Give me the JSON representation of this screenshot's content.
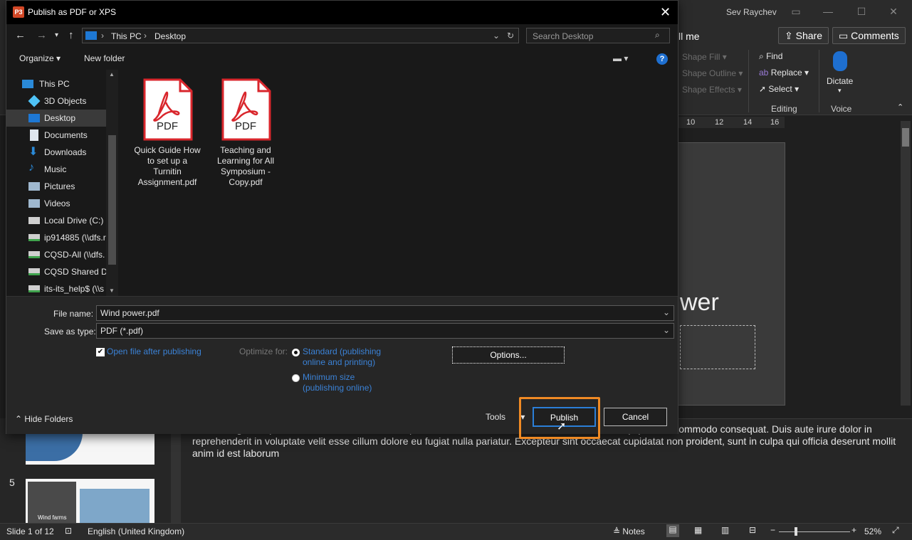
{
  "dialog": {
    "title": "Publish as PDF or XPS",
    "app_icon_text": "P3",
    "breadcrumb": [
      "This PC",
      "Desktop"
    ],
    "search_placeholder": "Search Desktop",
    "organize_label": "Organize",
    "new_folder_label": "New folder",
    "help_label": "?",
    "sidebar_items": [
      {
        "label": "This PC",
        "icon": "computer-icon"
      },
      {
        "label": "3D Objects",
        "icon": "cube-icon"
      },
      {
        "label": "Desktop",
        "icon": "desktop-icon"
      },
      {
        "label": "Documents",
        "icon": "document-icon"
      },
      {
        "label": "Downloads",
        "icon": "download-icon"
      },
      {
        "label": "Music",
        "icon": "music-icon"
      },
      {
        "label": "Pictures",
        "icon": "picture-icon"
      },
      {
        "label": "Videos",
        "icon": "video-icon"
      },
      {
        "label": "Local Drive (C:)",
        "icon": "drive-icon"
      },
      {
        "label": "ip914885 (\\\\dfs.r",
        "icon": "network-drive-icon"
      },
      {
        "label": "CQSD-All (\\\\dfs.",
        "icon": "network-drive-icon"
      },
      {
        "label": "CQSD Shared Dr",
        "icon": "network-drive-icon"
      },
      {
        "label": "its-its_help$ (\\\\s",
        "icon": "network-drive-icon"
      }
    ],
    "files": [
      {
        "name": "Quick Guide How to set up a Turnitin Assignment.pdf",
        "badge": "PDF"
      },
      {
        "name": "Teaching and Learning for All Symposium - Copy.pdf",
        "badge": "PDF"
      }
    ],
    "file_name_label": "File name:",
    "file_name_value": "Wind power.pdf",
    "save_type_label": "Save as type:",
    "save_type_value": "PDF (*.pdf)",
    "open_after_label": "Open file after publishing",
    "optimize_label": "Optimize for:",
    "standard_label": "Standard (publishing online and printing)",
    "minimum_label": "Minimum size (publishing online)",
    "options_label": "Options...",
    "hide_folders_label": "Hide Folders",
    "tools_label": "Tools",
    "publish_label": "Publish",
    "cancel_label": "Cancel"
  },
  "ppt": {
    "user_name": "Sev Raychev",
    "tell_me": "ll me",
    "share_label": "Share",
    "comments_label": "Comments",
    "shape_fill": "Shape Fill",
    "shape_outline": "Shape Outline",
    "shape_effects": "Shape Effects",
    "find_label": "Find",
    "replace_label": "Replace",
    "select_label": "Select",
    "editing_label": "Editing",
    "dictate_label": "Dictate",
    "voice_label": "Voice",
    "ruler_ticks": [
      "10",
      "12",
      "14",
      "16"
    ],
    "slide_title_fragment": "wer",
    "notes_text": "..olore magna aliqua. Ut enim ad minim veniam, quis nostrud exercitation ullamco laboris nisi ut aliquip ex ea commodo consequat. Duis aute irure dolor in reprehenderit in voluptate velit esse cillum dolore eu fugiat nulla pariatur. Excepteur sint occaecat cupidatat non proident, sunt in culpa qui officia deserunt mollit anim id est laborum",
    "thumb_number": "5",
    "thumb_caption": "Wind farms",
    "status_slide": "Slide 1 of 12",
    "status_language": "English (United Kingdom)",
    "notes_label": "Notes",
    "zoom_level": "52%"
  },
  "colors": {
    "accent_orange": "#f08a24",
    "link_blue": "#3b82d6",
    "pdf_red": "#d9262c"
  }
}
